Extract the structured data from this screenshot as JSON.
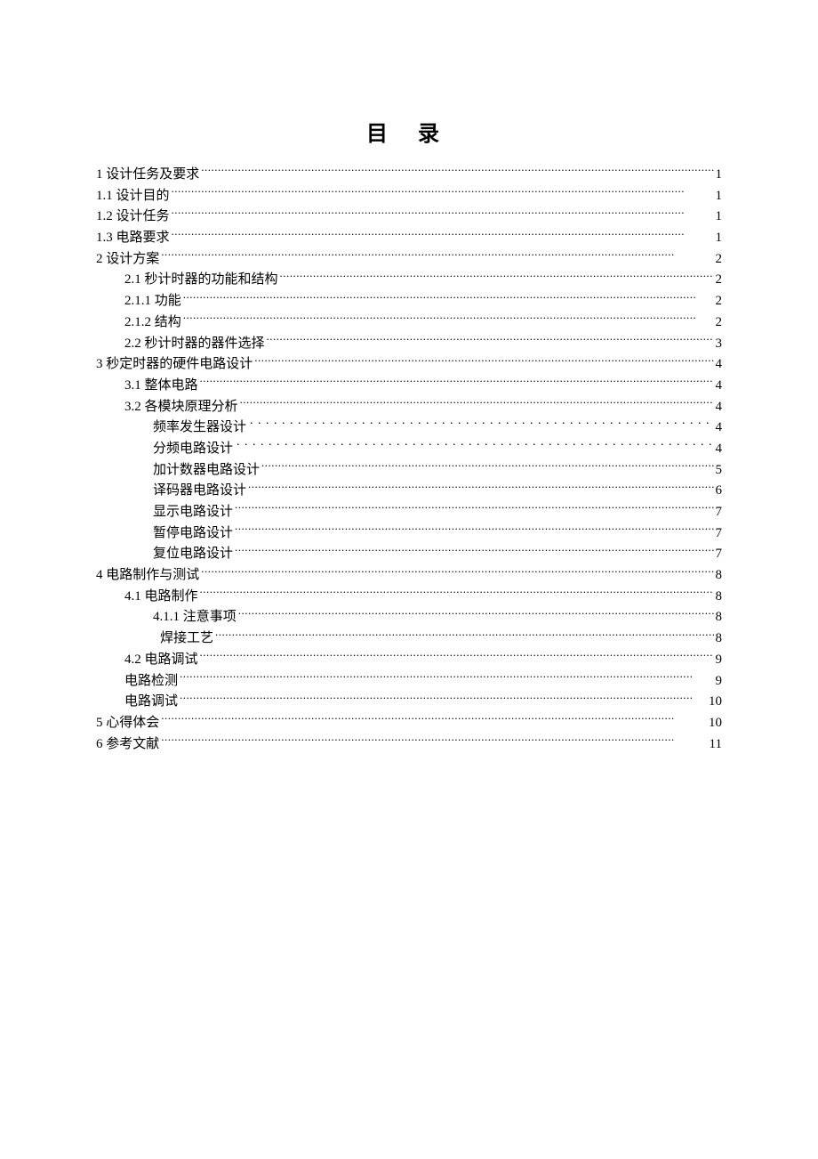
{
  "title": "目 录",
  "toc": [
    {
      "text": "1 设计任务及要求",
      "page": "1",
      "indent": 0,
      "leader": "dense"
    },
    {
      "text": "1.1 设计目的",
      "page": "1",
      "indent": 0,
      "leader": "dense"
    },
    {
      "text": "1.2 设计任务",
      "page": "1",
      "indent": 0,
      "leader": "dense"
    },
    {
      "text": "1.3 电路要求",
      "page": "1",
      "indent": 0,
      "leader": "dense"
    },
    {
      "text": "2 设计方案",
      "page": "2",
      "indent": 0,
      "leader": "dense"
    },
    {
      "text": "2.1 秒计时器的功能和结构",
      "page": "2",
      "indent": 1,
      "leader": "dense"
    },
    {
      "text": "2.1.1 功能",
      "page": "2",
      "indent": 1,
      "leader": "dense"
    },
    {
      "text": "2.1.2 结构",
      "page": "2",
      "indent": 1,
      "leader": "dense"
    },
    {
      "text": "2.2 秒计时器的器件选择",
      "page": "3",
      "indent": 1,
      "leader": "dense"
    },
    {
      "text": "3 秒定时器的硬件电路设计",
      "page": "4",
      "indent": 0,
      "leader": "dense"
    },
    {
      "text": "3.1 整体电路",
      "page": "4",
      "indent": 1,
      "leader": "dense"
    },
    {
      "text": "3.2 各模块原理分析",
      "page": "4",
      "indent": 1,
      "leader": "dense"
    },
    {
      "text": "频率发生器设计",
      "page": "4",
      "indent": 2,
      "leader": "sparse"
    },
    {
      "text": "分频电路设计",
      "page": "4",
      "indent": 2,
      "leader": "sparse"
    },
    {
      "text": "加计数器电路设计",
      "page": "5",
      "indent": 2,
      "leader": "dense"
    },
    {
      "text": "译码器电路设计",
      "page": "6",
      "indent": 2,
      "leader": "dense"
    },
    {
      "text": "显示电路设计",
      "page": "7",
      "indent": 2,
      "leader": "dense"
    },
    {
      "text": "暂停电路设计",
      "page": "7",
      "indent": 2,
      "leader": "dense"
    },
    {
      "text": "复位电路设计",
      "page": "7",
      "indent": 2,
      "leader": "dense"
    },
    {
      "text": "4 电路制作与测试",
      "page": "8",
      "indent": 0,
      "leader": "dense"
    },
    {
      "text": "4.1 电路制作",
      "page": "8",
      "indent": 1,
      "leader": "dense"
    },
    {
      "text": "4.1.1 注意事项",
      "page": "8",
      "indent": 2,
      "leader": "dense"
    },
    {
      "text": " 焊接工艺",
      "page": "8",
      "indent": 2,
      "leader": "dense",
      "extraIndent": true
    },
    {
      "text": "4.2 电路调试",
      "page": "9",
      "indent": 1,
      "leader": "dense"
    },
    {
      "text": "电路检测",
      "page": "9",
      "indent": 1,
      "leader": "dense"
    },
    {
      "text": "电路调试",
      "page": "10",
      "indent": 1,
      "leader": "dense"
    },
    {
      "text": "5 心得体会",
      "page": "10",
      "indent": 0,
      "leader": "dense"
    },
    {
      "text": "6 参考文献",
      "page": "11",
      "indent": 0,
      "leader": "dense"
    }
  ]
}
